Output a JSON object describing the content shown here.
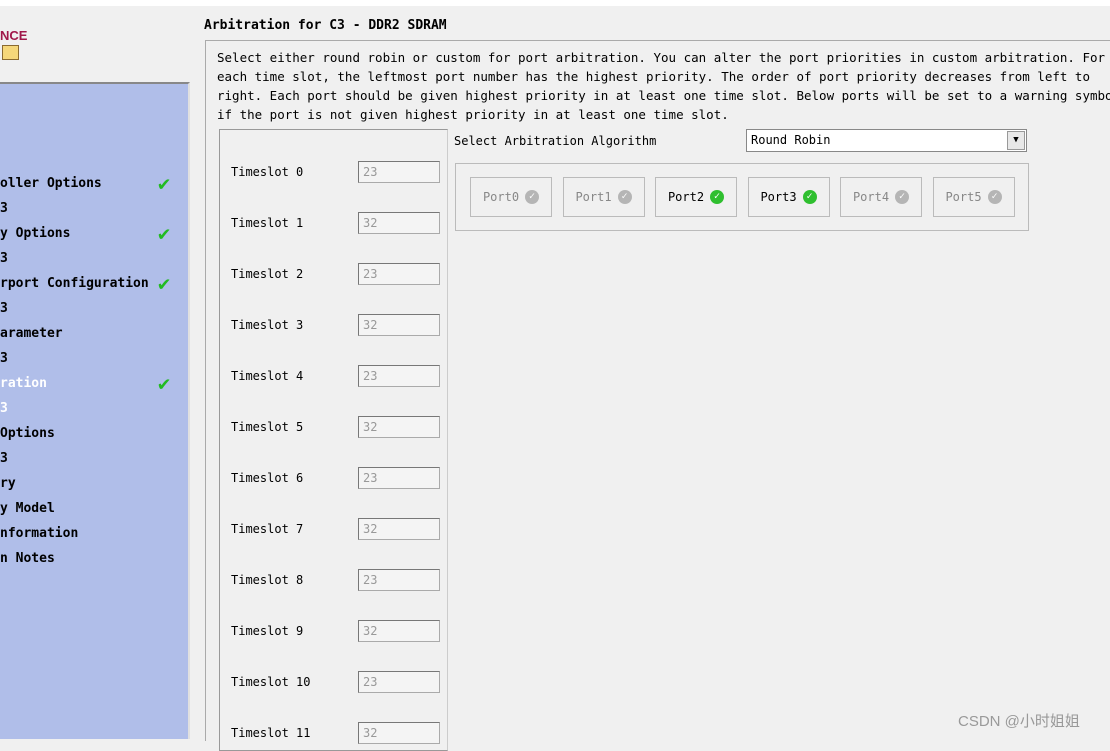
{
  "logo_text": "NCE",
  "sidebar": {
    "items": [
      {
        "label": "oller Options",
        "check": true,
        "active": false
      },
      {
        "label": "3",
        "check": false,
        "active": false
      },
      {
        "label": "y Options",
        "check": true,
        "active": false
      },
      {
        "label": "3",
        "check": false,
        "active": false
      },
      {
        "label": "rport Configuration",
        "check": true,
        "active": false
      },
      {
        "label": "3",
        "check": false,
        "active": false
      },
      {
        "label": "arameter",
        "check": false,
        "active": false
      },
      {
        "label": "3",
        "check": false,
        "active": false
      },
      {
        "label": "ration",
        "check": true,
        "active": true
      },
      {
        "label": "3",
        "check": false,
        "active": true
      },
      {
        "label": "Options",
        "check": false,
        "active": false
      },
      {
        "label": "3",
        "check": false,
        "active": false
      },
      {
        "label": "ry",
        "check": false,
        "active": false
      },
      {
        "label": "y Model",
        "check": false,
        "active": false
      },
      {
        "label": "nformation",
        "check": false,
        "active": false
      },
      {
        "label": "n Notes",
        "check": false,
        "active": false
      }
    ]
  },
  "main": {
    "title": "Arbitration for C3 - DDR2 SDRAM",
    "description": "Select either round robin or custom for port arbitration. You can alter the port priorities in custom arbitration. For\neach time slot, the leftmost port number has the highest priority. The order of port priority decreases from left to\nright. Each port should be given highest priority in at least one time slot. Below ports will be set to a warning symbol\nif the port is not given highest priority in at least one time slot.",
    "algorithm_label": "Select Arbitration Algorithm",
    "algorithm_value": "Round Robin",
    "timeslots": [
      {
        "label": "Timeslot 0",
        "value": "23"
      },
      {
        "label": "Timeslot 1",
        "value": "32"
      },
      {
        "label": "Timeslot 2",
        "value": "23"
      },
      {
        "label": "Timeslot 3",
        "value": "32"
      },
      {
        "label": "Timeslot 4",
        "value": "23"
      },
      {
        "label": "Timeslot 5",
        "value": "32"
      },
      {
        "label": "Timeslot 6",
        "value": "23"
      },
      {
        "label": "Timeslot 7",
        "value": "32"
      },
      {
        "label": "Timeslot 8",
        "value": "23"
      },
      {
        "label": "Timeslot 9",
        "value": "32"
      },
      {
        "label": "Timeslot 10",
        "value": "23"
      },
      {
        "label": "Timeslot 11",
        "value": "32"
      }
    ],
    "ports": [
      {
        "label": "Port0",
        "enabled": false
      },
      {
        "label": "Port1",
        "enabled": false
      },
      {
        "label": "Port2",
        "enabled": true
      },
      {
        "label": "Port3",
        "enabled": true
      },
      {
        "label": "Port4",
        "enabled": false
      },
      {
        "label": "Port5",
        "enabled": false
      }
    ]
  },
  "watermark": "CSDN @小时姐姐",
  "colors": {
    "sidebar_bg": "#b0bee9",
    "check_green": "#22bb22",
    "logo": "#a0184a"
  }
}
